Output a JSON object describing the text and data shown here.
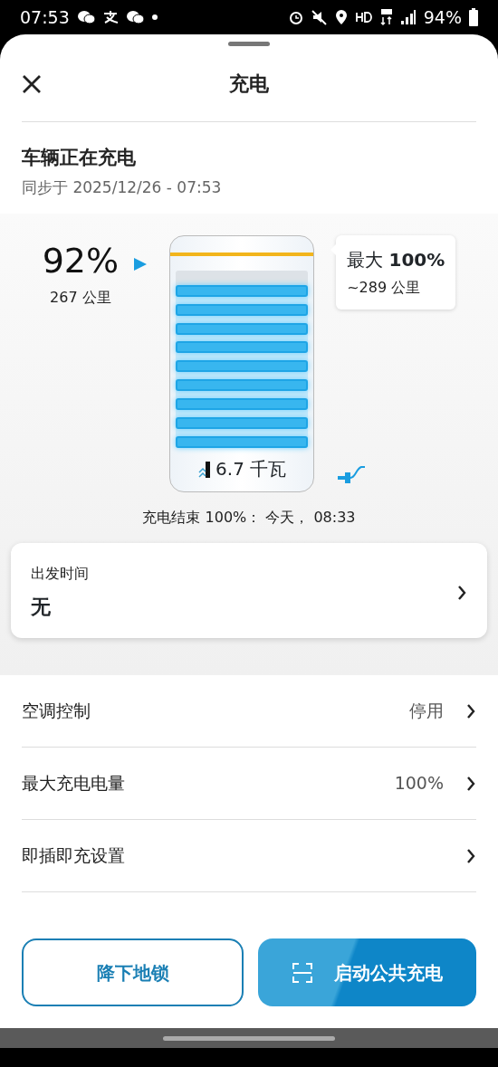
{
  "status_bar": {
    "time": "07:53",
    "battery": "94%"
  },
  "header": {
    "title": "充电"
  },
  "charging_status": {
    "title": "车辆正在充电",
    "synced": "同步于 2025/12/26 - 07:53"
  },
  "battery": {
    "level": 0.92,
    "percent": "92%",
    "range": "267 公里",
    "max_label": "最大",
    "max_value": "100%",
    "max_range": "~289 公里",
    "power": "6.7 千瓦",
    "end_text": "充电结束 100%： 今天， 08:33"
  },
  "departure": {
    "label": "出发时间",
    "value": "无"
  },
  "settings": [
    {
      "label": "空调控制",
      "value": "停用"
    },
    {
      "label": "最大充电电量",
      "value": "100%"
    },
    {
      "label": "即插即充设置"
    }
  ],
  "buttons": [
    {
      "label": "降下地锁",
      "kind": "outline"
    },
    {
      "label": "启动公共充电",
      "kind": "primary"
    }
  ]
}
